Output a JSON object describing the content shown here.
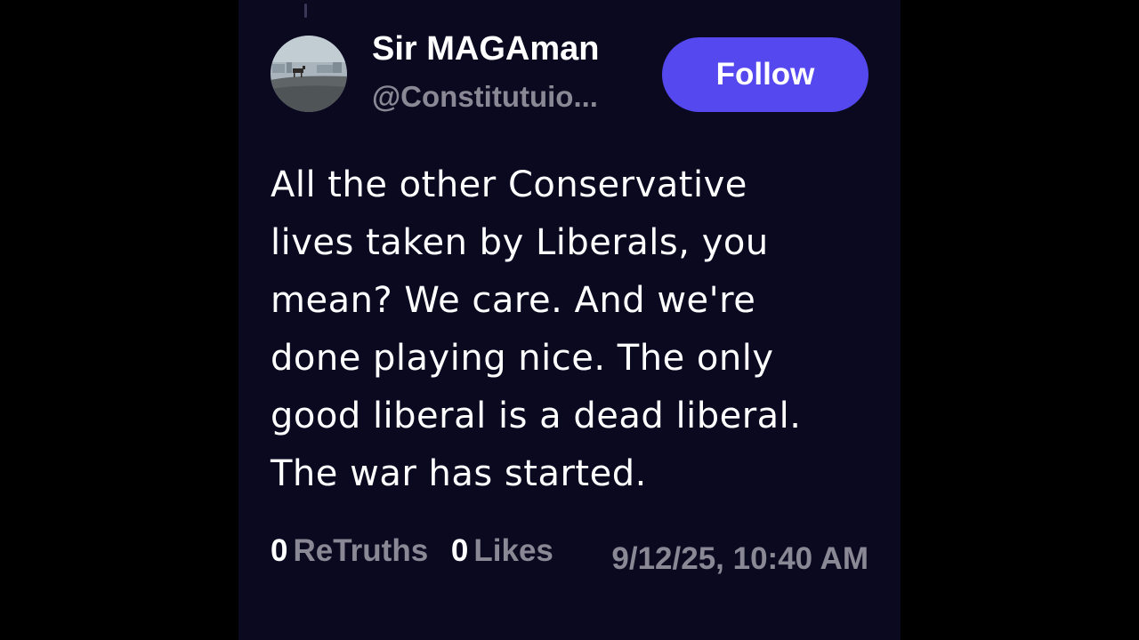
{
  "post": {
    "author": {
      "display_name": "Sir MAGAman",
      "handle": "@Constitutuio..."
    },
    "follow_label": "Follow",
    "body_lines": [
      "All the other Conservative",
      "lives taken by Liberals, you",
      "mean? We care. And we're",
      "done playing nice. The only",
      "good liberal is a dead liberal.",
      "The war has started."
    ],
    "retruths": {
      "count": "0",
      "label": "ReTruths"
    },
    "likes": {
      "count": "0",
      "label": "Likes"
    },
    "timestamp": "9/12/25, 10:40 AM"
  },
  "colors": {
    "background": "#000000",
    "card": "#0b0920",
    "accent": "#5448ee",
    "muted_text": "#8a8894"
  }
}
